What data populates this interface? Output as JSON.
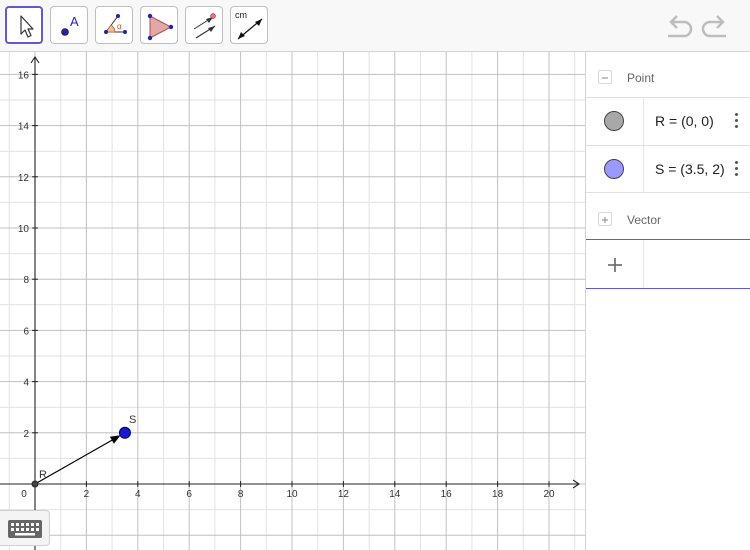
{
  "toolbar": {
    "tools": [
      {
        "name": "move-tool",
        "label": ""
      },
      {
        "name": "point-tool",
        "label": "A"
      },
      {
        "name": "angle-tool",
        "label": "α"
      },
      {
        "name": "polygon-tool",
        "label": ""
      },
      {
        "name": "vector-tool",
        "label": ""
      },
      {
        "name": "distance-tool",
        "label": "cm"
      }
    ],
    "selected_tool": "move-tool",
    "undo_icon": "undo-icon",
    "redo_icon": "redo-icon"
  },
  "graphics": {
    "x_range": [
      -1.3,
      21.3
    ],
    "y_range": [
      -2.5,
      16.7
    ],
    "major_grid_step": 2,
    "minor_grid_step": 1,
    "x_ticks": [
      0,
      2,
      4,
      6,
      8,
      10,
      12,
      14,
      16,
      18,
      20
    ],
    "y_ticks": [
      2,
      4,
      6,
      8,
      10,
      12,
      14,
      16
    ],
    "points": [
      {
        "name": "R",
        "x": 0,
        "y": 0,
        "color": "#444444"
      },
      {
        "name": "S",
        "x": 3.5,
        "y": 2,
        "color": "#1a1acc"
      }
    ],
    "vector": {
      "from": "R",
      "to": "S",
      "color": "#000000"
    },
    "keyboard_icon": "keyboard-icon"
  },
  "algebra": {
    "groups": [
      {
        "label": "Point",
        "toggle": "minus-icon"
      },
      {
        "label": "Vector",
        "toggle": "plus-icon"
      }
    ],
    "items": [
      {
        "text": "R = (0, 0)",
        "marble_color": "#a8a8a8"
      },
      {
        "text": "S = (3.5, 2)",
        "marble_color": "#9999ff"
      }
    ],
    "input_placeholder": ""
  }
}
